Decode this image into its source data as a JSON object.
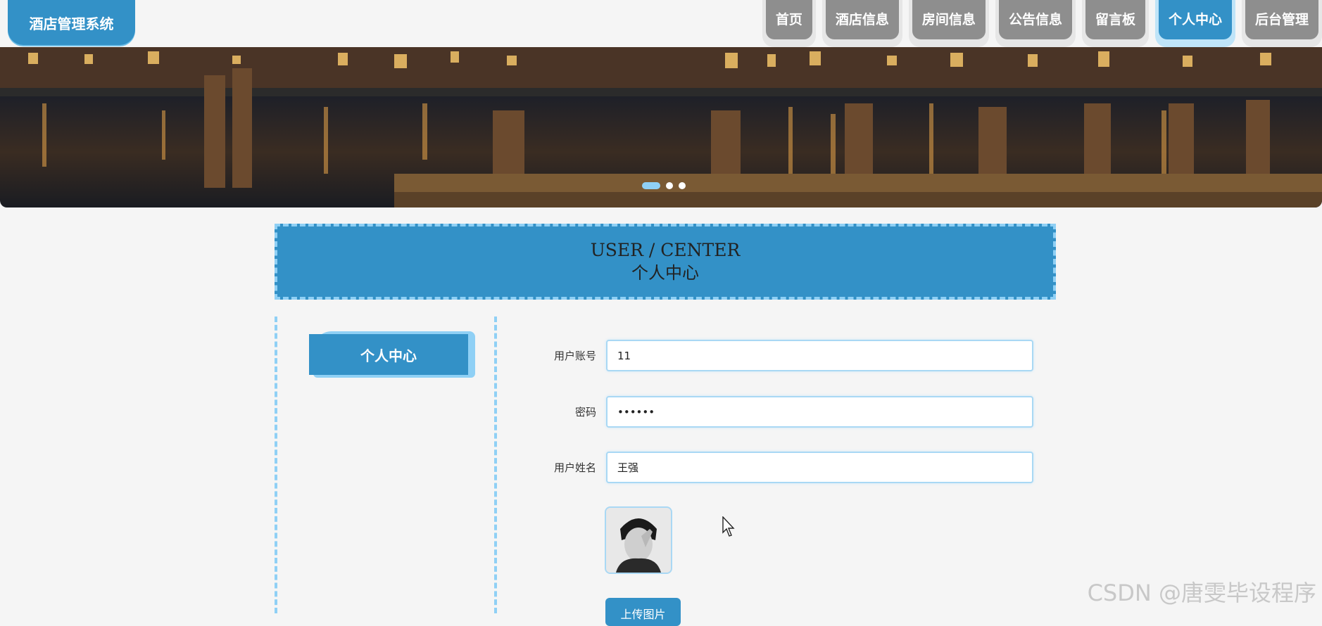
{
  "brand": {
    "title": "酒店管理系统"
  },
  "nav": {
    "items": [
      {
        "label": "首页",
        "active": false
      },
      {
        "label": "酒店信息",
        "active": false
      },
      {
        "label": "房间信息",
        "active": false
      },
      {
        "label": "公告信息",
        "active": false
      },
      {
        "label": "留言板",
        "active": false
      },
      {
        "label": "个人中心",
        "active": true
      },
      {
        "label": "后台管理",
        "active": false
      }
    ]
  },
  "banner": {
    "slides_total": 3,
    "active_slide": 1
  },
  "title_box": {
    "en": "USER / CENTER",
    "cn": "个人中心"
  },
  "sidebar": {
    "items": [
      {
        "label": "个人中心",
        "active": true
      }
    ]
  },
  "form": {
    "username_label": "用户账号",
    "username_value": "11",
    "password_label": "密码",
    "password_value": "••••••",
    "name_label": "用户姓名",
    "name_value": "王强",
    "upload_label": "上传图片"
  },
  "watermark": "CSDN @唐雯毕设程序",
  "colors": {
    "primary": "#3391c7",
    "accent": "#8fd0f5",
    "nav_inactive": "#8e8e8e",
    "background": "#f5f5f5"
  }
}
